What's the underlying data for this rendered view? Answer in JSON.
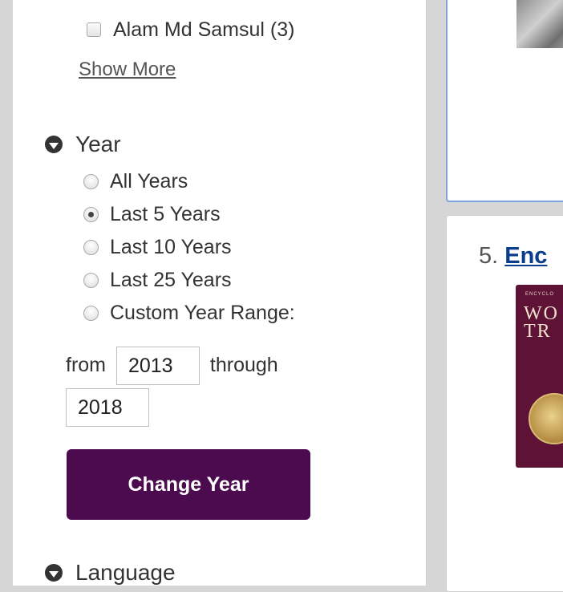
{
  "author_facet": {
    "checkbox_label": "Alam Md Samsul (3)",
    "show_more": "Show More"
  },
  "year_facet": {
    "title": "Year",
    "options": [
      {
        "label": "All Years",
        "checked": false
      },
      {
        "label": "Last 5 Years",
        "checked": true
      },
      {
        "label": "Last 10 Years",
        "checked": false
      },
      {
        "label": "Last 25 Years",
        "checked": false
      },
      {
        "label": "Custom Year Range:",
        "checked": false
      }
    ],
    "from_label": "from",
    "from_value": "2013",
    "through_label": "through",
    "through_value": "2018",
    "button_label": "Change Year"
  },
  "language_facet": {
    "title": "Language"
  },
  "results": {
    "item5_number": "5.",
    "item5_title": "Enc",
    "item5_cover_text": "WO\nTR",
    "item5_cover_small": "ENCYCLO"
  },
  "colors": {
    "button": "#4c0b4e",
    "link": "#0a3e8c",
    "card_border_selected": "#7fa4d9"
  }
}
